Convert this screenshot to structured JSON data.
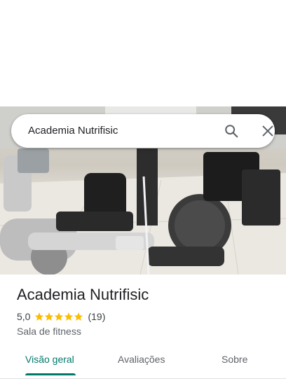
{
  "search": {
    "query": "Academia Nutrifisic"
  },
  "photo": {
    "description_icon": "gym-photo"
  },
  "place": {
    "title": "Academia Nutrifisic",
    "rating": "5,0",
    "stars": 5,
    "review_count": "(19)",
    "category": "Sala de fitness"
  },
  "tabs": [
    {
      "label": "Visão geral",
      "active": true
    },
    {
      "label": "Avaliações",
      "active": false
    },
    {
      "label": "Sobre",
      "active": false
    }
  ],
  "colors": {
    "accent": "#00796b",
    "star": "#fbbc04",
    "text_primary": "#202124",
    "text_secondary": "#5f6368"
  }
}
